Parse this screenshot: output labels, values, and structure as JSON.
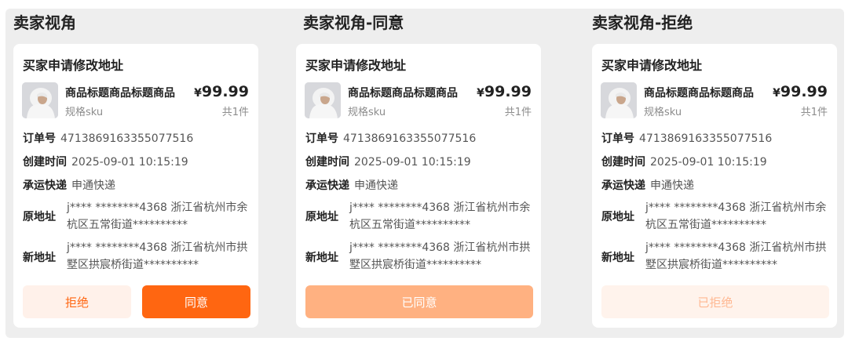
{
  "colors": {
    "accent": "#ff6611",
    "accent_light": "#fff1ea",
    "accent_disabled": "#ffb181",
    "bg": "#eeeeee"
  },
  "columns": [
    {
      "title": "卖家视角",
      "card": {
        "title": "买家申请修改地址",
        "product": {
          "name": "商品标题商品标题商品",
          "sku": "规格sku",
          "price_symbol": "¥",
          "price": "99.99",
          "qty": "共1件"
        },
        "order_label": "订单号",
        "order_no": "4713869163355077516",
        "created_label": "创建时间",
        "created": "2025-09-01 10:15:19",
        "carrier_label": "承运快递",
        "carrier": "申通快递",
        "old_label": "原地址",
        "old_addr": "j**** ********4368 浙江省杭州市余杭区五常街道**********",
        "new_label": "新地址",
        "new_addr": "j**** ********4368 浙江省杭州市拱墅区拱宸桥街道**********",
        "buttons": {
          "reject": "拒绝",
          "agree": "同意"
        }
      }
    },
    {
      "title": "卖家视角-同意",
      "card": {
        "title": "买家申请修改地址",
        "product": {
          "name": "商品标题商品标题商品",
          "sku": "规格sku",
          "price_symbol": "¥",
          "price": "99.99",
          "qty": "共1件"
        },
        "order_label": "订单号",
        "order_no": "4713869163355077516",
        "created_label": "创建时间",
        "created": "2025-09-01 10:15:19",
        "carrier_label": "承运快递",
        "carrier": "申通快递",
        "old_label": "原地址",
        "old_addr": "j**** ********4368 浙江省杭州市余杭区五常街道**********",
        "new_label": "新地址",
        "new_addr": "j**** ********4368 浙江省杭州市拱墅区拱宸桥街道**********",
        "status": "已同意"
      }
    },
    {
      "title": "卖家视角-拒绝",
      "card": {
        "title": "买家申请修改地址",
        "product": {
          "name": "商品标题商品标题商品",
          "sku": "规格sku",
          "price_symbol": "¥",
          "price": "99.99",
          "qty": "共1件"
        },
        "order_label": "订单号",
        "order_no": "4713869163355077516",
        "created_label": "创建时间",
        "created": "2025-09-01 10:15:19",
        "carrier_label": "承运快递",
        "carrier": "申通快递",
        "old_label": "原地址",
        "old_addr": "j**** ********4368 浙江省杭州市余杭区五常街道**********",
        "new_label": "新地址",
        "new_addr": "j**** ********4368 浙江省杭州市拱墅区拱宸桥街道**********",
        "status": "已拒绝"
      }
    }
  ]
}
